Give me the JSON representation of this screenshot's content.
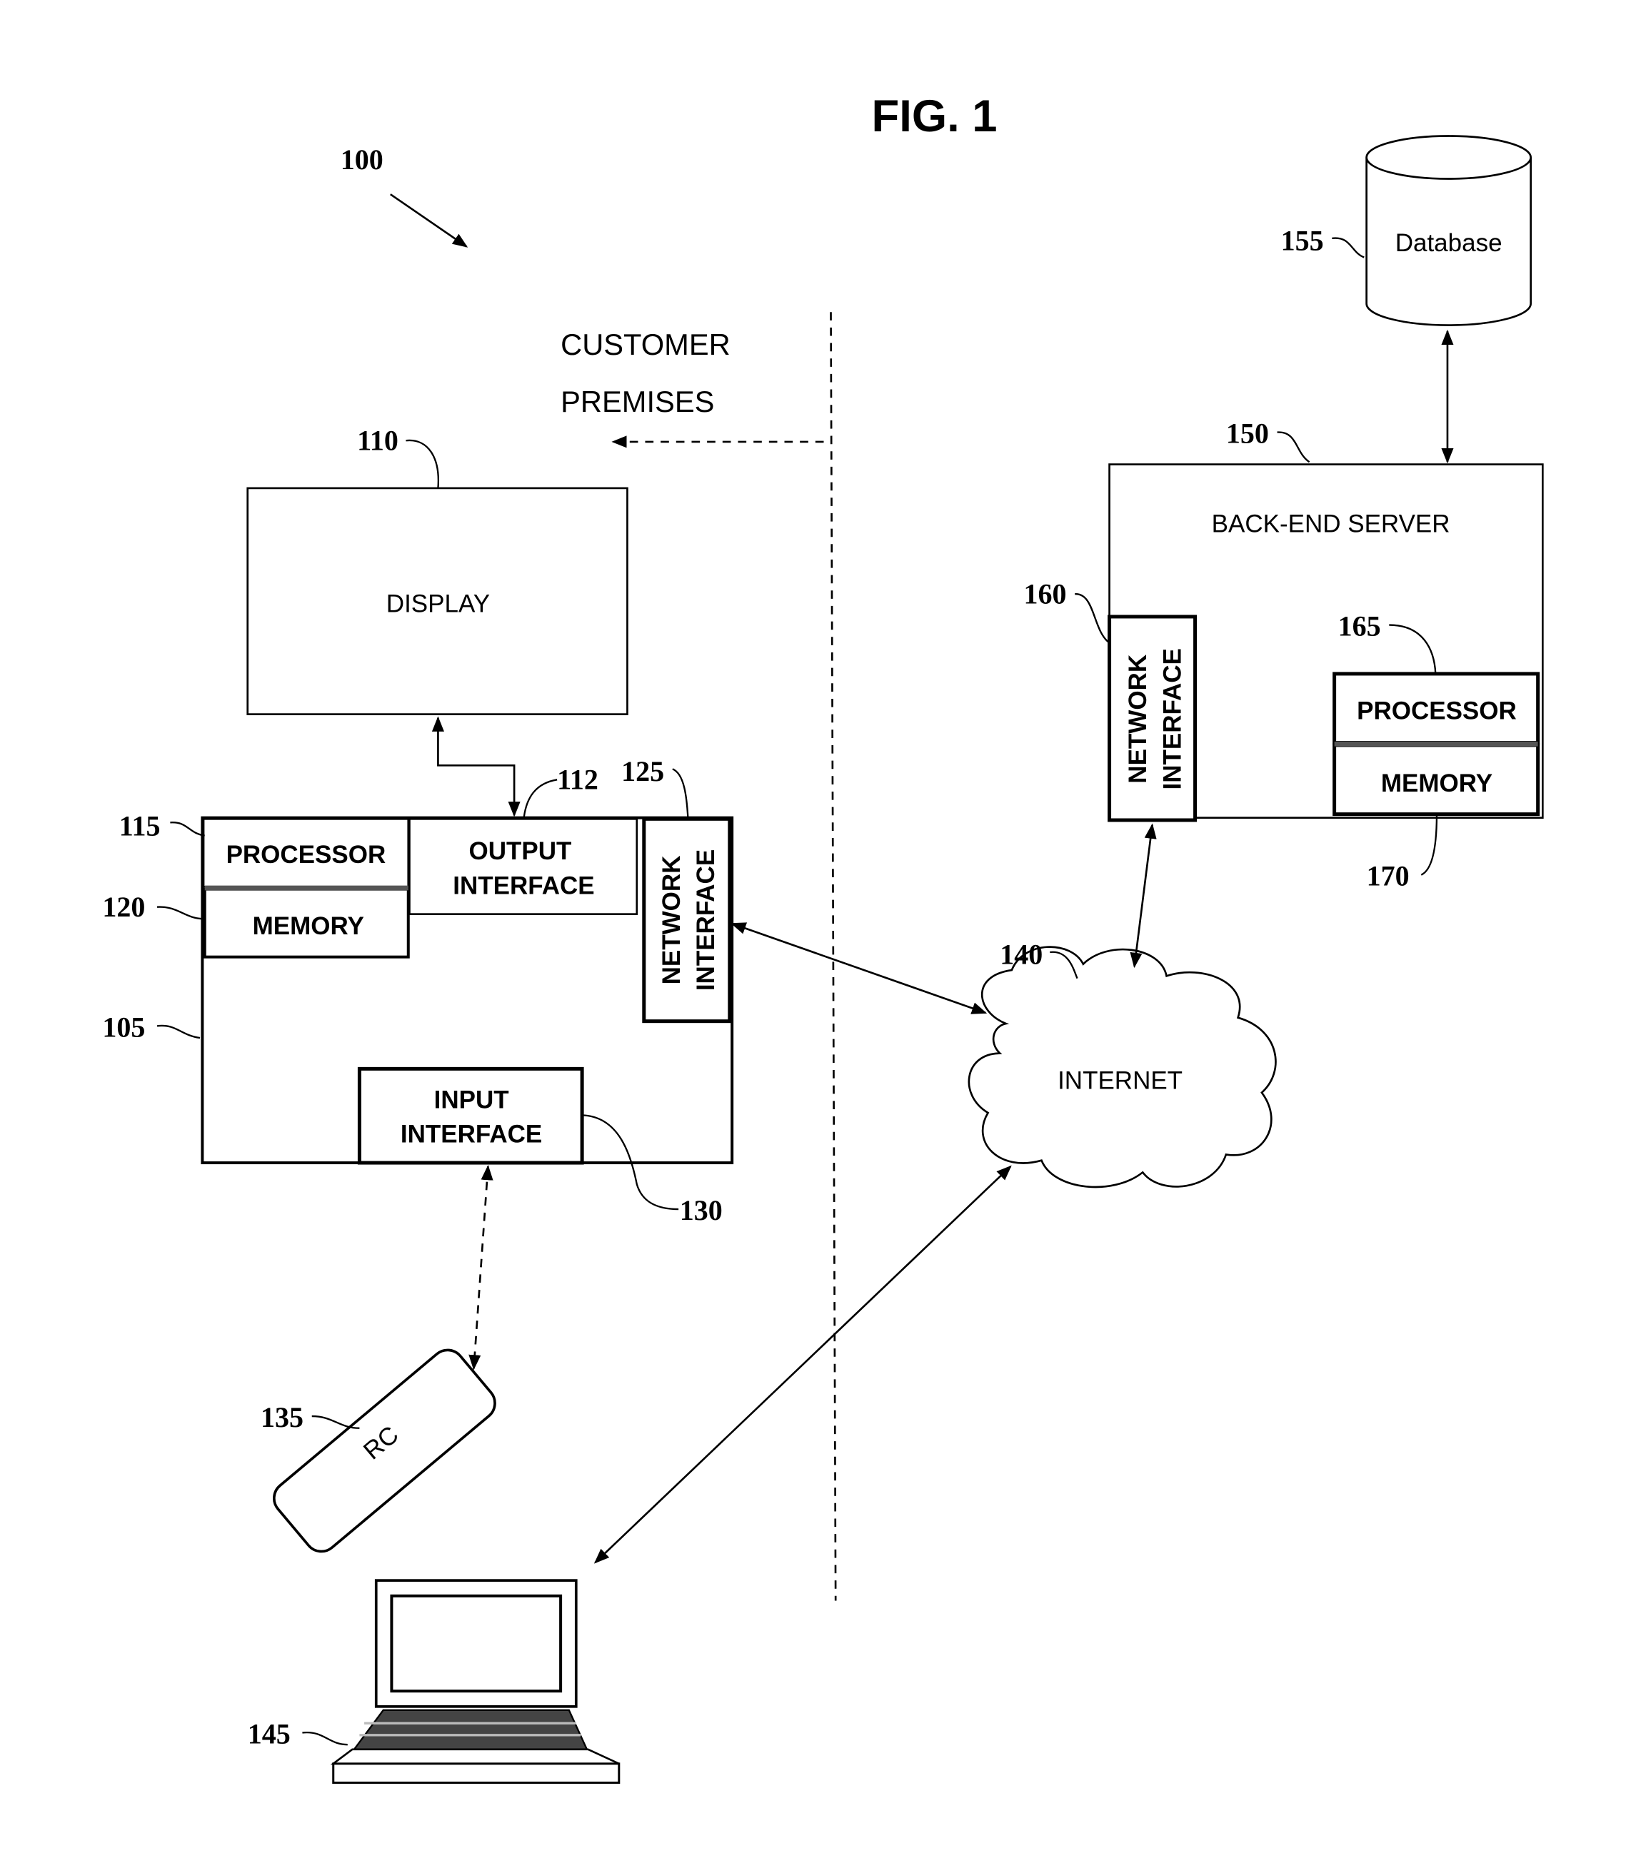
{
  "figure": {
    "title": "FIG. 1",
    "system_ref": "100",
    "region_label_line1": "CUSTOMER",
    "region_label_line2": "PREMISES"
  },
  "customer_device": {
    "ref": "105",
    "display": {
      "ref": "110",
      "label": "DISPLAY"
    },
    "output_interface": {
      "ref": "112",
      "line1": "OUTPUT",
      "line2": "INTERFACE"
    },
    "processor": {
      "ref": "115",
      "label": "PROCESSOR"
    },
    "memory": {
      "ref": "120",
      "label": "MEMORY"
    },
    "network_interface": {
      "ref": "125",
      "line1": "NETWORK",
      "line2": "INTERFACE"
    },
    "input_interface": {
      "ref": "130",
      "line1": "INPUT",
      "line2": "INTERFACE"
    }
  },
  "remote_control": {
    "ref": "135",
    "label": "RC"
  },
  "internet": {
    "ref": "140",
    "label": "INTERNET"
  },
  "laptop": {
    "ref": "145"
  },
  "back_end_server": {
    "ref": "150",
    "label": "BACK-END SERVER",
    "network_interface": {
      "ref": "160",
      "line1": "NETWORK",
      "line2": "INTERFACE"
    },
    "processor": {
      "ref": "165",
      "label": "PROCESSOR"
    },
    "memory": {
      "ref": "170",
      "label": "MEMORY"
    }
  },
  "database": {
    "ref": "155",
    "label": "Database"
  }
}
